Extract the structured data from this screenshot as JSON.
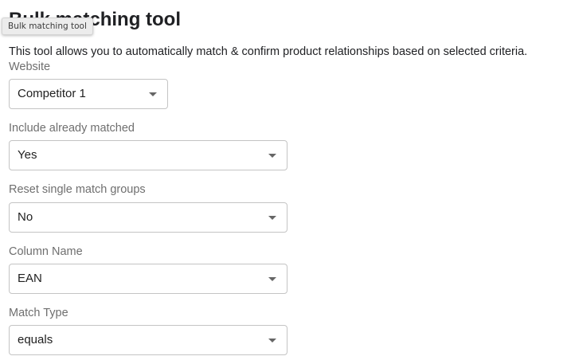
{
  "page": {
    "title": "Bulk matching tool",
    "tooltip": "Bulk matching tool",
    "description": "This tool allows you to automatically match & confirm product relationships based on selected criteria."
  },
  "form": {
    "website": {
      "label": "Website",
      "value": "Competitor 1"
    },
    "include_matched": {
      "label": "Include already matched",
      "value": "Yes"
    },
    "reset_groups": {
      "label": "Reset single match groups",
      "value": "No"
    },
    "column_name": {
      "label": "Column Name",
      "value": "EAN"
    },
    "match_type": {
      "label": "Match Type",
      "value": "equals"
    }
  },
  "icons": {
    "select_caret": "caret-down-icon"
  }
}
